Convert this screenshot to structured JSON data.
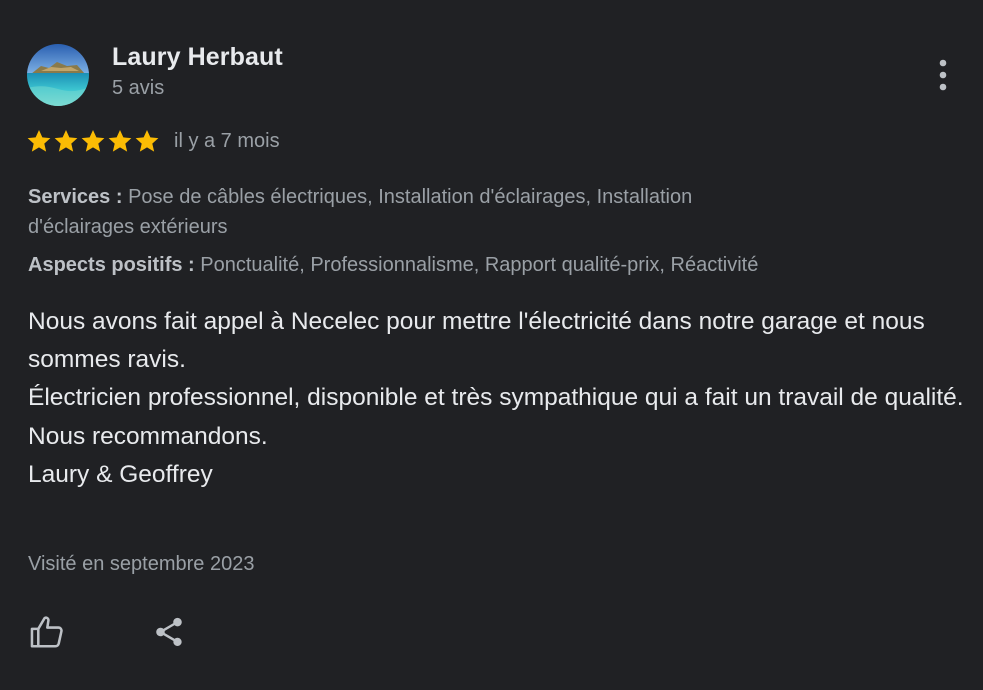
{
  "reviewer": {
    "name": "Laury Herbaut",
    "review_count": "5 avis",
    "avatar_icon": "beach-photo-avatar"
  },
  "rating": {
    "stars": 5,
    "max_stars": 5,
    "star_color": "#fbbc04",
    "date": "il y a 7 mois"
  },
  "attributes": {
    "services_label": "Services :",
    "services_value": "Pose de câbles électriques, Installation d'éclairages, Installation d'éclairages extérieurs",
    "positifs_label": "Aspects positifs :",
    "positifs_value": "Ponctualité, Professionnalisme, Rapport qualité-prix, Réactivité"
  },
  "review": {
    "lines": [
      "Nous avons fait appel à Necelec pour mettre l'électricité dans notre garage et nous sommes ravis.",
      "Électricien professionnel, disponible et très sympathique qui a fait un travail de qualité.",
      "Nous recommandons.",
      "Laury & Geoffrey"
    ]
  },
  "visited": "Visité en septembre 2023",
  "actions": {
    "more_icon": "more-vert-icon",
    "like_icon": "thumbs-up-icon",
    "share_icon": "share-icon"
  },
  "colors": {
    "background": "#202124",
    "primary_text": "#e8eaed",
    "secondary_text": "#9aa0a6"
  }
}
